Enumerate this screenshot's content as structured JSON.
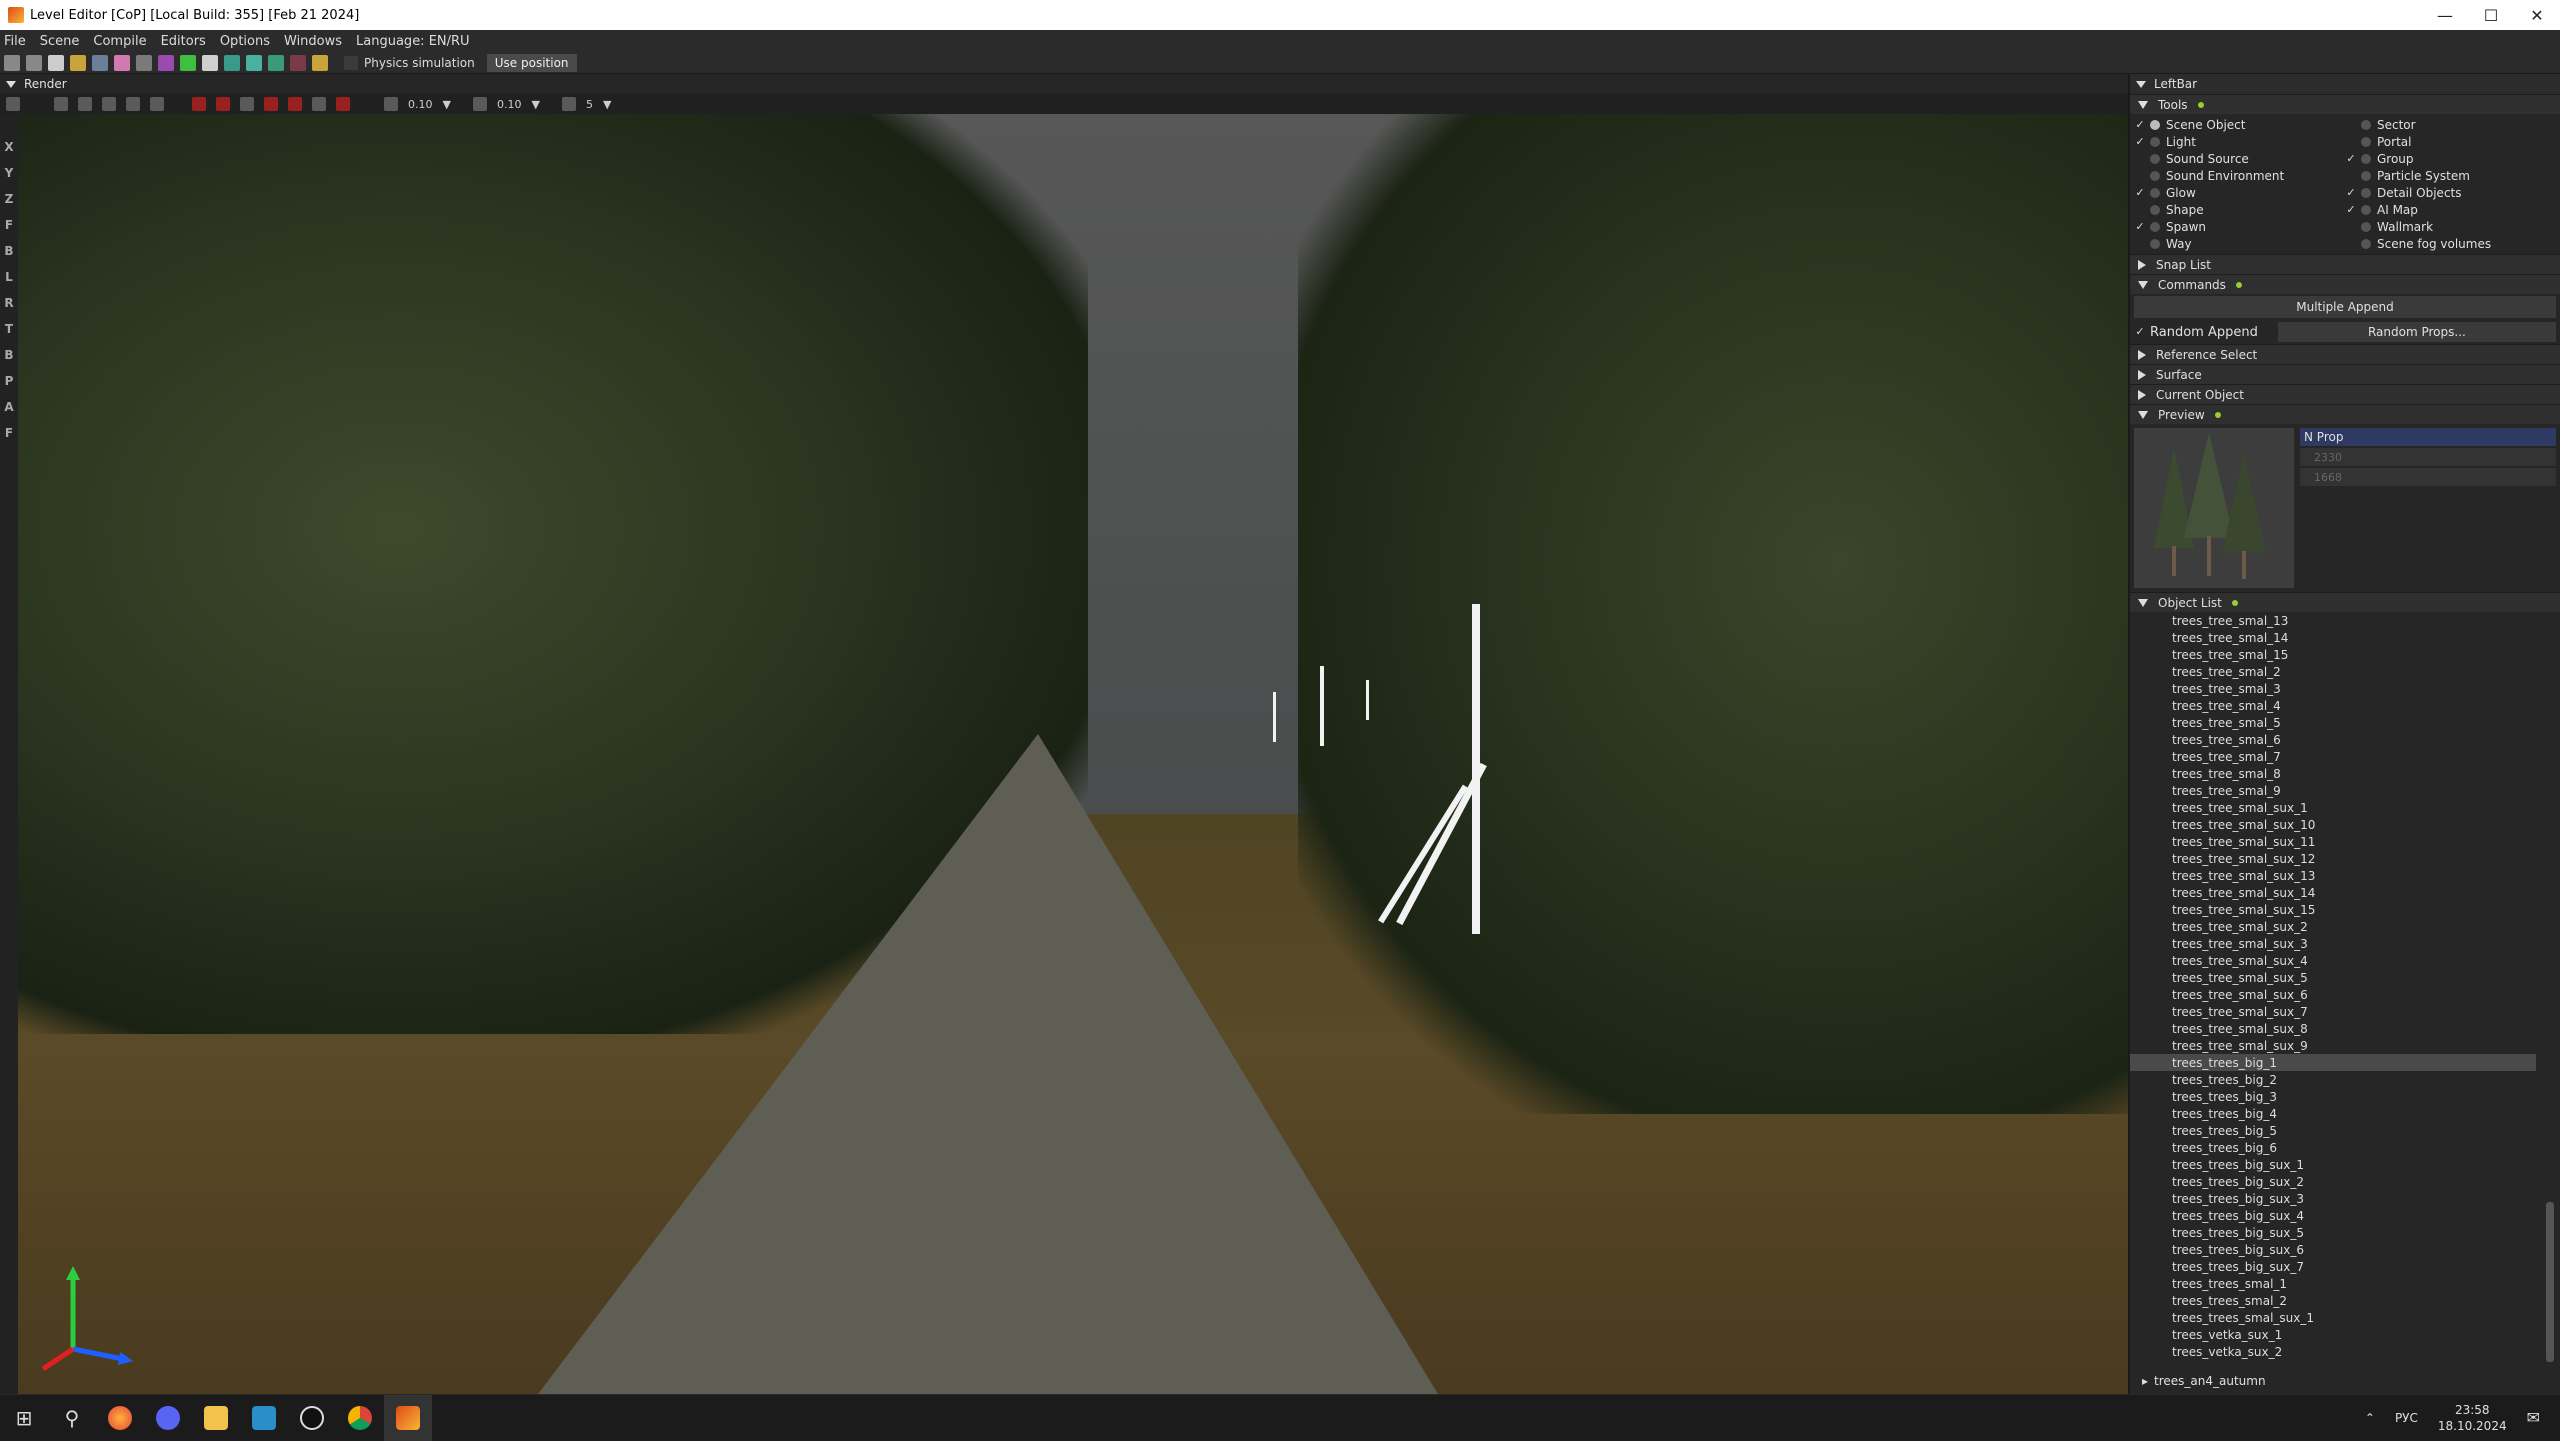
{
  "window": {
    "title": "Level Editor [CoP] [Local Build: 355] [Feb 21 2024]"
  },
  "menu": [
    "File",
    "Scene",
    "Compile",
    "Editors",
    "Options",
    "Windows",
    "Language: EN/RU"
  ],
  "toolbar": {
    "physics_label": "Physics simulation",
    "use_position_label": "Use position"
  },
  "render": {
    "title": "Render",
    "move_snap": "0.10",
    "scale_snap": "0.10",
    "angle_snap": "5",
    "side_letters": [
      "X",
      "Y",
      "Z",
      "F",
      "B",
      "L",
      "R",
      "T",
      "B",
      "P",
      "A",
      "F"
    ]
  },
  "leftbar": {
    "title": "LeftBar",
    "tools": {
      "label": "Tools",
      "items_left": [
        {
          "label": "Scene Object",
          "checked": true,
          "active": true
        },
        {
          "label": "Light",
          "checked": true
        },
        {
          "label": "Sound Source",
          "checked": false
        },
        {
          "label": "Sound Environment",
          "checked": false
        },
        {
          "label": "Glow",
          "checked": true
        },
        {
          "label": "Shape",
          "checked": false
        },
        {
          "label": "Spawn",
          "checked": true
        },
        {
          "label": "Way",
          "checked": false
        }
      ],
      "items_right": [
        {
          "label": "Sector",
          "checked": false
        },
        {
          "label": "Portal",
          "checked": false
        },
        {
          "label": "Group",
          "checked": true
        },
        {
          "label": "Particle System",
          "checked": false
        },
        {
          "label": "Detail Objects",
          "checked": true
        },
        {
          "label": "AI Map",
          "checked": true
        },
        {
          "label": "Wallmark",
          "checked": false
        },
        {
          "label": "Scene fog volumes",
          "checked": false
        }
      ]
    },
    "snap_list": "Snap List",
    "commands": {
      "label": "Commands",
      "multiple_append": "Multiple Append",
      "random_append": "Random Append",
      "random_props": "Random Props..."
    },
    "reference_select": "Reference Select",
    "surface": "Surface",
    "current_object": "Current Object",
    "preview": {
      "label": "Preview",
      "prop_label": "N Prop",
      "faces": "2330",
      "vertices": "1668"
    },
    "object_list": {
      "label": "Object List",
      "items": [
        "trees_tree_smal_13",
        "trees_tree_smal_14",
        "trees_tree_smal_15",
        "trees_tree_smal_2",
        "trees_tree_smal_3",
        "trees_tree_smal_4",
        "trees_tree_smal_5",
        "trees_tree_smal_6",
        "trees_tree_smal_7",
        "trees_tree_smal_8",
        "trees_tree_smal_9",
        "trees_tree_smal_sux_1",
        "trees_tree_smal_sux_10",
        "trees_tree_smal_sux_11",
        "trees_tree_smal_sux_12",
        "trees_tree_smal_sux_13",
        "trees_tree_smal_sux_14",
        "trees_tree_smal_sux_15",
        "trees_tree_smal_sux_2",
        "trees_tree_smal_sux_3",
        "trees_tree_smal_sux_4",
        "trees_tree_smal_sux_5",
        "trees_tree_smal_sux_6",
        "trees_tree_smal_sux_7",
        "trees_tree_smal_sux_8",
        "trees_tree_smal_sux_9",
        "trees_trees_big_1",
        "trees_trees_big_2",
        "trees_trees_big_3",
        "trees_trees_big_4",
        "trees_trees_big_5",
        "trees_trees_big_6",
        "trees_trees_big_sux_1",
        "trees_trees_big_sux_2",
        "trees_trees_big_sux_3",
        "trees_trees_big_sux_4",
        "trees_trees_big_sux_5",
        "trees_trees_big_sux_6",
        "trees_trees_big_sux_7",
        "trees_trees_smal_1",
        "trees_trees_smal_2",
        "trees_trees_smal_sux_1",
        "trees_vetka_sux_1",
        "trees_vetka_sux_2"
      ],
      "selected_index": 26,
      "folder": "trees_an4_autumn"
    }
  },
  "taskbar": {
    "lang": "РУС",
    "time": "23:58",
    "date": "18.10.2024"
  },
  "colors": {
    "accent_dot": "#9acd32",
    "selected_prop": "#2e3a62"
  }
}
